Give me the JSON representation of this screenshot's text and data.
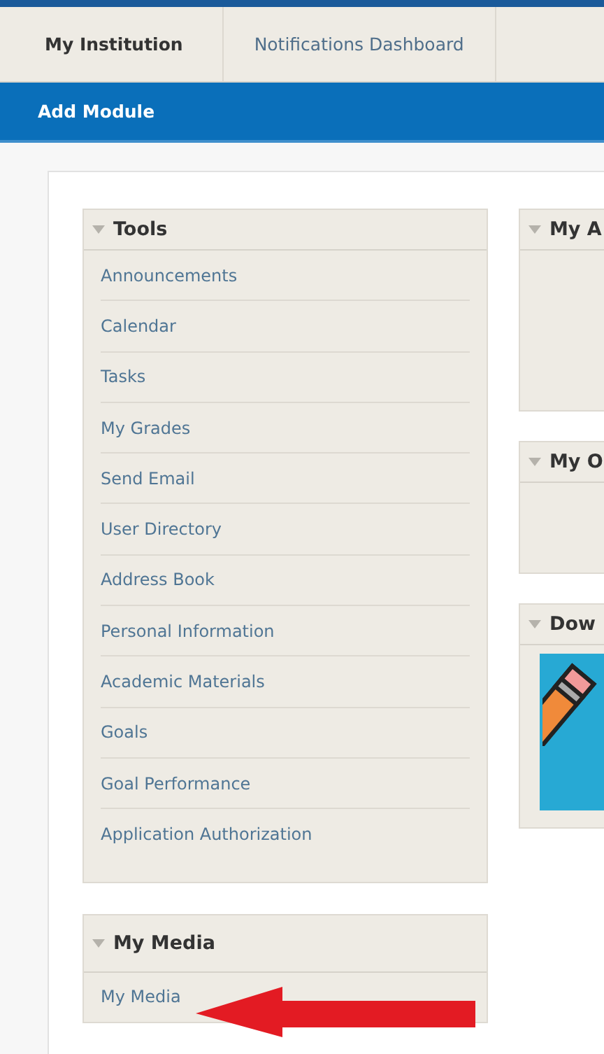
{
  "tabs": [
    {
      "label": "My Institution",
      "selected": true
    },
    {
      "label": "Notifications Dashboard",
      "selected": false
    }
  ],
  "toolbar": {
    "button": "Add Module"
  },
  "left_modules": [
    {
      "title": "Tools",
      "expanded": true,
      "items": [
        "Announcements",
        "Calendar",
        "Tasks",
        "My Grades",
        "Send Email",
        "User Directory",
        "Address Book",
        "Personal Information",
        "Academic Materials",
        "Goals",
        "Goal Performance",
        "Application Authorization"
      ]
    },
    {
      "title": "My Media",
      "expanded": true,
      "items": [
        "My Media"
      ]
    }
  ],
  "right_modules": [
    {
      "title": "My A",
      "kind": "blank",
      "expanded": true
    },
    {
      "title": "My O",
      "kind": "blank",
      "expanded": true
    },
    {
      "title": "Dow",
      "kind": "image",
      "expanded": true
    }
  ]
}
